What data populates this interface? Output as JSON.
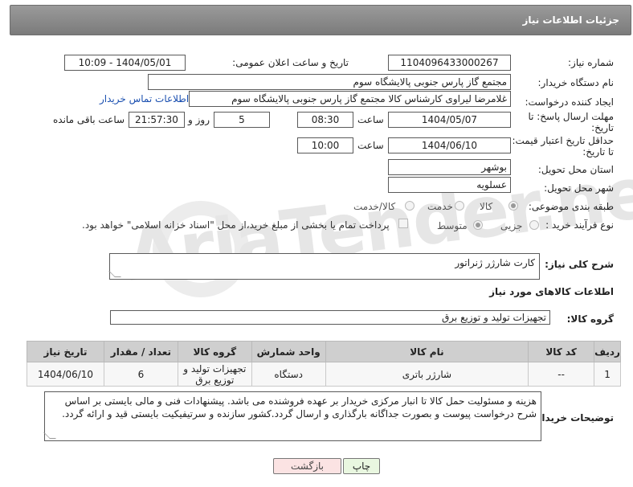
{
  "header": {
    "title": "جزئیات اطلاعات نیاز"
  },
  "form": {
    "need_number_label": "شماره نیاز:",
    "need_number": "1104096433000267",
    "announce_label": "تاریخ و ساعت اعلان عمومی:",
    "announce_value": "1404/05/01 - 10:09",
    "buyer_org_label": "نام دستگاه خریدار:",
    "buyer_org": "مجتمع گاز پارس جنوبی  پالایشگاه سوم",
    "creator_label": "ایجاد کننده درخواست:",
    "creator": "غلامرضا لیراوی کارشناس کالا مجتمع گاز پارس جنوبی  پالایشگاه سوم",
    "contact_link": "اطلاعات تماس خریدار",
    "reply_deadline_label_1": "مهلت ارسال پاسخ: تا",
    "reply_deadline_label_2": "تاریخ:",
    "reply_date": "1404/05/07",
    "time_label": "ساعت",
    "reply_time": "08:30",
    "days_value": "5",
    "days_label": "روز و",
    "remaining_time": "21:57:30",
    "remaining_label": "ساعت باقی مانده",
    "price_validity_label_1": "حداقل تاریخ اعتبار قیمت:",
    "price_validity_label_2": "تا تاریخ:",
    "validity_date": "1404/06/10",
    "validity_time": "10:00",
    "province_label": "استان محل تحویل:",
    "province": "بوشهر",
    "city_label": "شهر محل تحویل:",
    "city": "عسلویه",
    "category_label": "طبقه بندی موضوعی:",
    "category_options": [
      "کالا",
      "خدمت",
      "کالا/خدمت"
    ],
    "process_label": "نوع فرآیند خرید :",
    "process_options": [
      "جزیی",
      "متوسط"
    ],
    "payment_note": "پرداخت تمام یا بخشی از مبلغ خرید،از محل \"اسناد خزانه اسلامی\" خواهد بود."
  },
  "description": {
    "label": "شرح کلی نیاز:",
    "value": "کارت شارژر ژنراتور"
  },
  "goods_section_title": "اطلاعات کالاهای مورد نیاز",
  "goods_group": {
    "label": "گروه کالا:",
    "value": "تجهیزات تولید و توزیع برق"
  },
  "table": {
    "headers": [
      "ردیف",
      "کد کالا",
      "نام کالا",
      "واحد شمارش",
      "گروه کالا",
      "تعداد / مقدار",
      "تاریخ نیاز"
    ],
    "rows": [
      [
        "1",
        "--",
        "شارژر باتری",
        "دستگاه",
        "تجهیزات تولید و توزیع برق",
        "6",
        "1404/06/10"
      ]
    ]
  },
  "buyer_notes": {
    "label": "توضیحات خریدار:",
    "value": "هزینه و مسئولیت حمل کالا تا انبار مرکزی خریدار بر عهده فروشنده می باشد. پیشنهادات فنی و مالی بایستی بر اساس شرح درخواست پیوست و بصورت جداگانه بارگذاری و ارسال گردد.کشور سازنده و سرتیفیکیت بایستی قید و ارائه گردد."
  },
  "buttons": {
    "print": "چاپ",
    "back": "بازگشت"
  },
  "watermark": "AriaTender.neT"
}
